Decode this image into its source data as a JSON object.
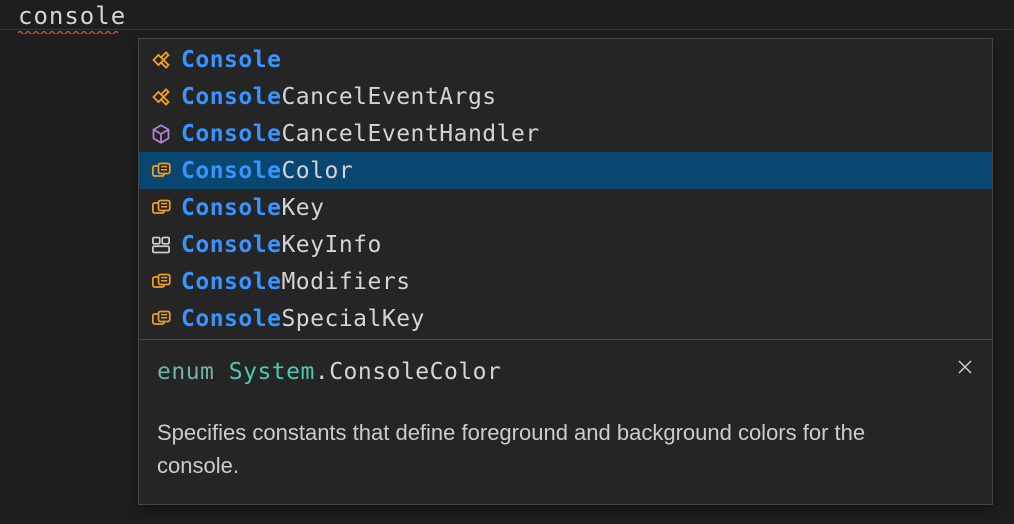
{
  "editor": {
    "typed_text": "console"
  },
  "suggestions": [
    {
      "icon": "class",
      "match": "Console",
      "rest": "",
      "selected": false
    },
    {
      "icon": "class",
      "match": "Console",
      "rest": "CancelEventArgs",
      "selected": false
    },
    {
      "icon": "box",
      "match": "Console",
      "rest": "CancelEventHandler",
      "selected": false
    },
    {
      "icon": "enum",
      "match": "Console",
      "rest": "Color",
      "selected": true
    },
    {
      "icon": "enum",
      "match": "Console",
      "rest": "Key",
      "selected": false
    },
    {
      "icon": "struct",
      "match": "Console",
      "rest": "KeyInfo",
      "selected": false
    },
    {
      "icon": "enum",
      "match": "Console",
      "rest": "Modifiers",
      "selected": false
    },
    {
      "icon": "enum",
      "match": "Console",
      "rest": "SpecialKey",
      "selected": false
    }
  ],
  "detail": {
    "keyword": "enum",
    "namespace": "System",
    "dot": ".",
    "type": "ConsoleColor",
    "description": "Specifies constants that define foreground and background colors for the console."
  },
  "icons": {
    "class_color": "#ee9d28",
    "box_color": "#b180d7",
    "enum_color": "#ee9d28",
    "struct_color": "#cccccc"
  }
}
